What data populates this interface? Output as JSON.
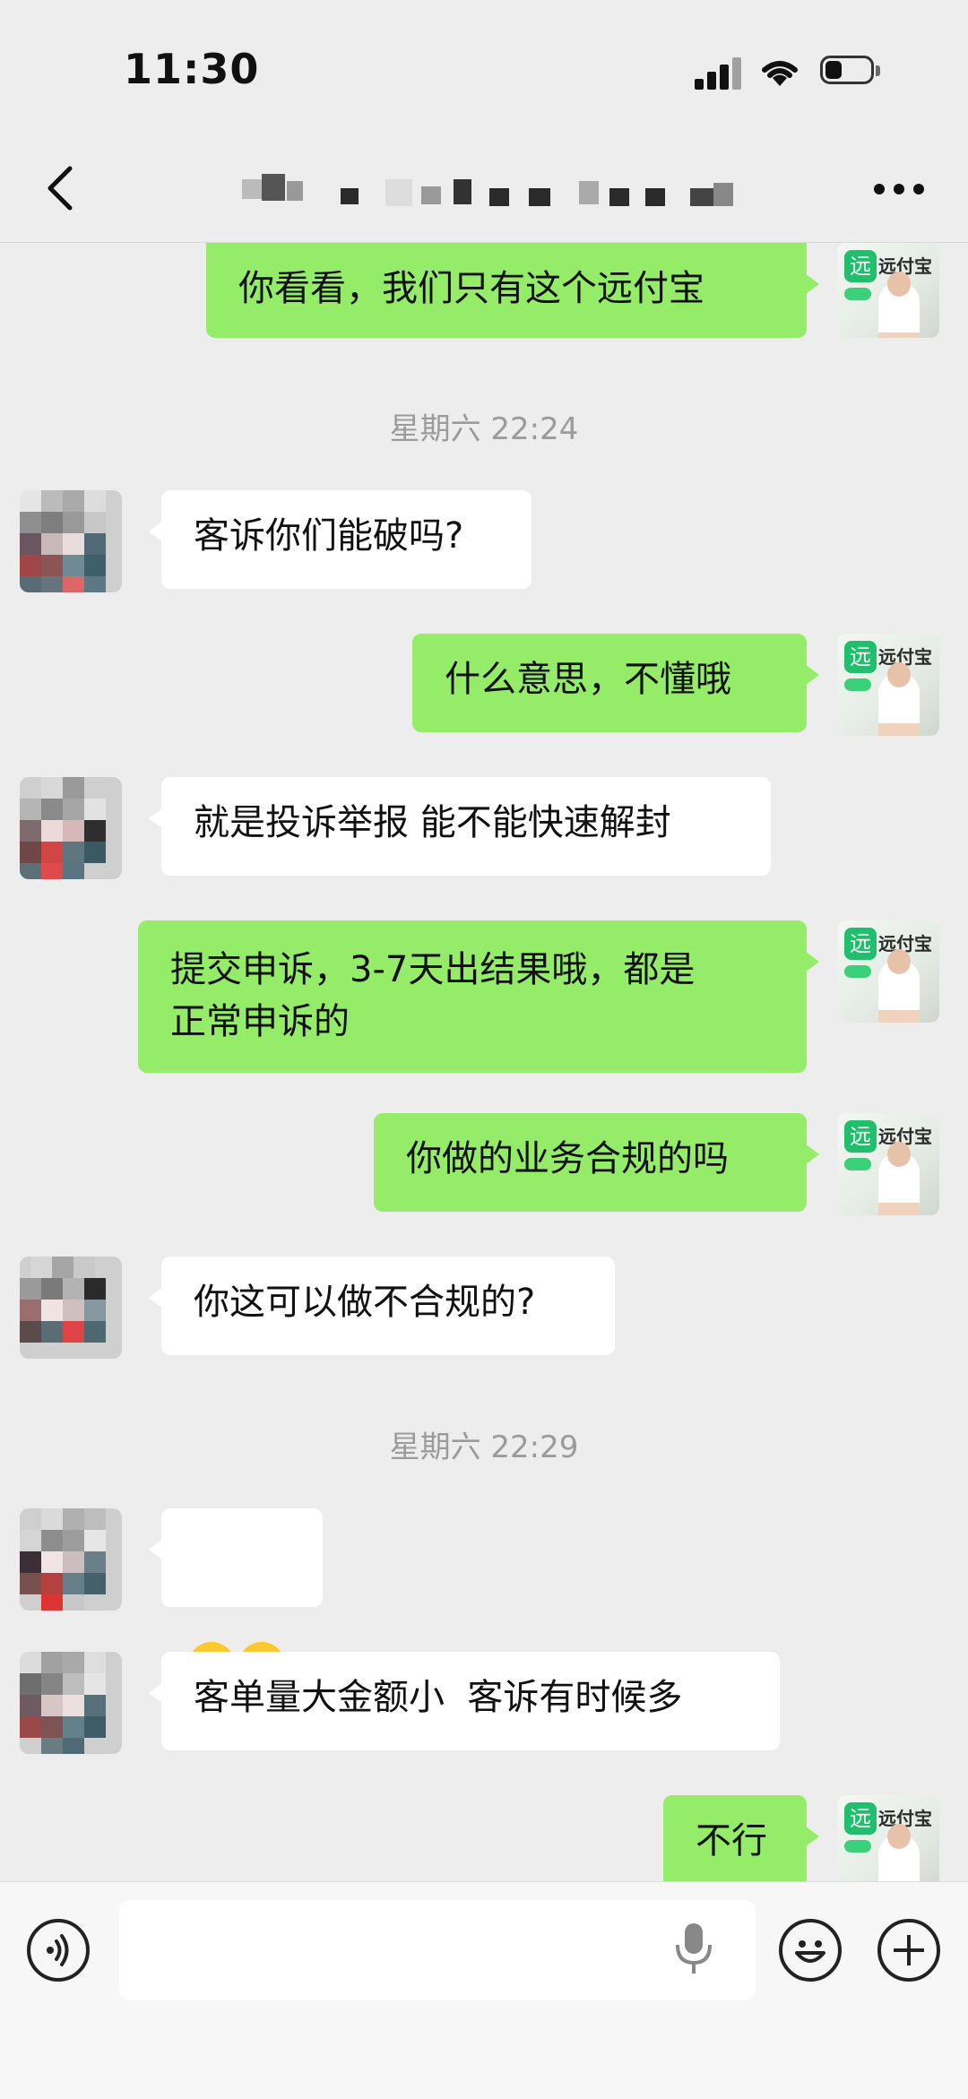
{
  "status_bar": {
    "time": "11:30"
  },
  "nav": {
    "title": "",
    "back_icon": "chevron-left-icon",
    "more_icon": "more-dots-icon"
  },
  "me": {
    "avatar_brand": "远付宝",
    "avatar_logo": "远"
  },
  "timestamps": [
    "星期六 22:24",
    "星期六 22:29"
  ],
  "messages": [
    {
      "dir": "out",
      "text": "你看看，我们只有这个远付宝"
    },
    {
      "dir": "in",
      "text": "客诉你们能破吗?"
    },
    {
      "dir": "out",
      "text": "什么意思，不懂哦"
    },
    {
      "dir": "in",
      "text": "就是投诉举报 能不能快速解封"
    },
    {
      "dir": "out",
      "text": "提交申诉，3-7天出结果哦，都是\n正常申诉的"
    },
    {
      "dir": "out",
      "text": "你做的业务合规的吗"
    },
    {
      "dir": "in",
      "text": "你这可以做不合规的?"
    },
    {
      "dir": "in",
      "text": "",
      "emoji": "crying-laughing-emoji x2"
    },
    {
      "dir": "in",
      "text": "客单量大金额小  客诉有时候多"
    },
    {
      "dir": "out",
      "text": "不行"
    }
  ],
  "input_bar": {
    "voice_icon": "voice-icon",
    "mic_icon": "microphone-icon",
    "emoji_icon": "emoji-icon",
    "plus_icon": "plus-icon",
    "input_value": ""
  }
}
